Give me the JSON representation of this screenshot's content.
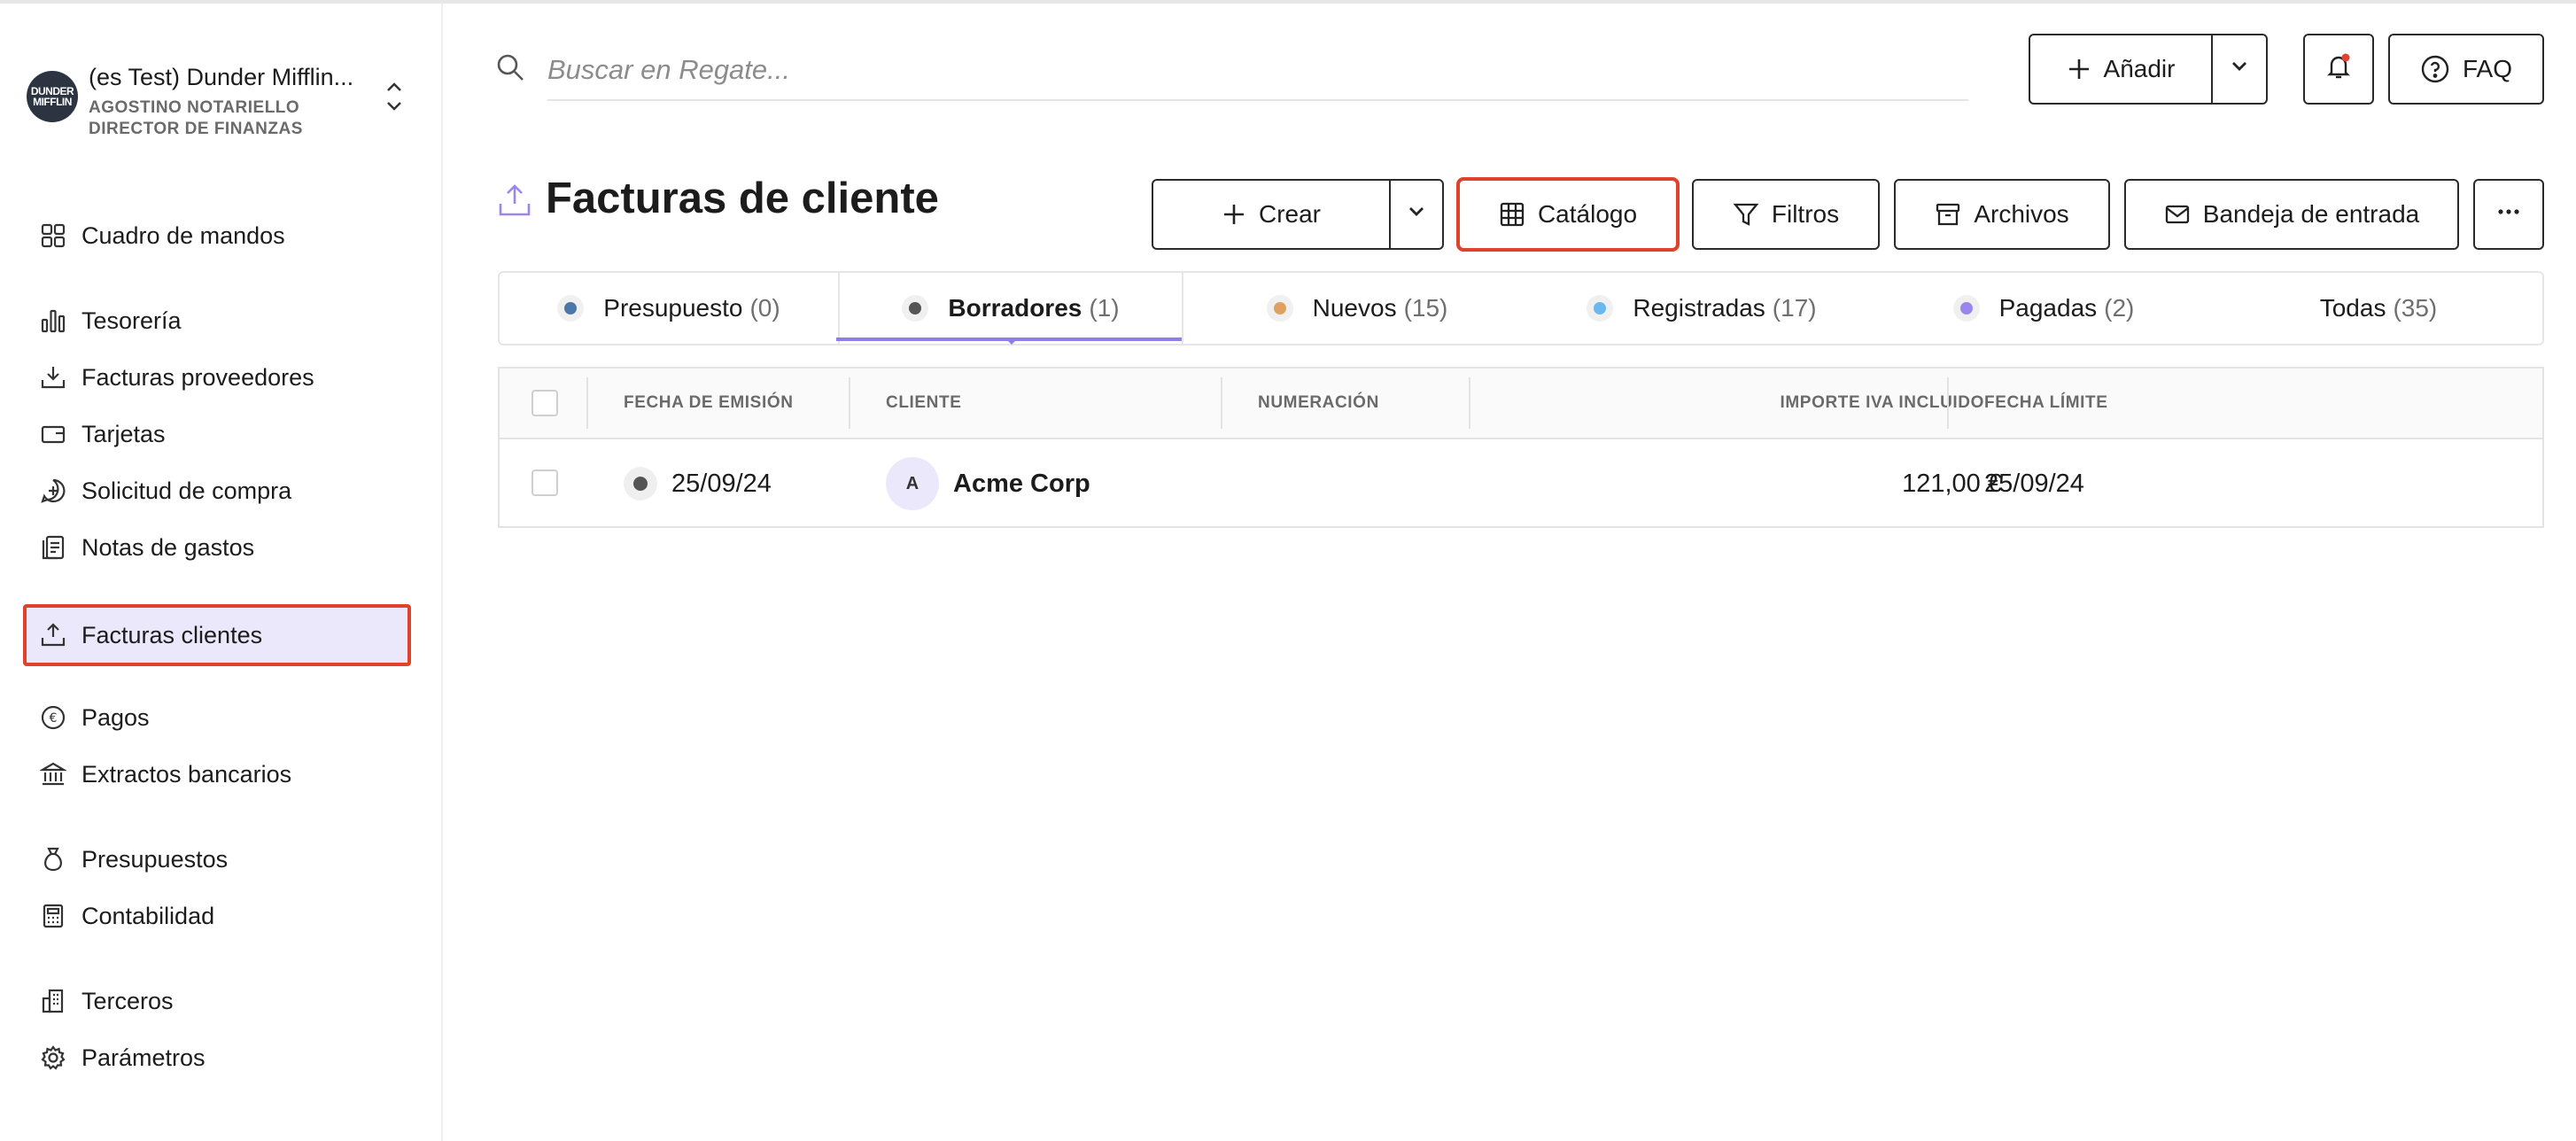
{
  "org": {
    "logo_text_1": "DUNDER",
    "logo_text_2": "MIFFLIN",
    "name": "(es Test) Dunder Mifflin...",
    "user_name": "AGOSTINO NOTARIELLO",
    "user_role": "DIRECTOR DE FINANZAS"
  },
  "sidebar": {
    "items": [
      {
        "label": "Cuadro de mandos",
        "icon": "dashboard-icon"
      },
      {
        "label": "Tesorería",
        "icon": "bar-chart-icon"
      },
      {
        "label": "Facturas proveedores",
        "icon": "download-tray-icon"
      },
      {
        "label": "Tarjetas",
        "icon": "wallet-icon"
      },
      {
        "label": "Solicitud de compra",
        "icon": "plus-chat-icon"
      },
      {
        "label": "Notas de gastos",
        "icon": "receipt-icon"
      },
      {
        "label": "Facturas clientes",
        "icon": "upload-tray-icon",
        "active": true
      },
      {
        "label": "Pagos",
        "icon": "euro-icon"
      },
      {
        "label": "Extractos bancarios",
        "icon": "bank-icon"
      },
      {
        "label": "Presupuestos",
        "icon": "money-bag-icon"
      },
      {
        "label": "Contabilidad",
        "icon": "calculator-icon"
      },
      {
        "label": "Terceros",
        "icon": "building-icon"
      },
      {
        "label": "Parámetros",
        "icon": "gear-icon"
      }
    ]
  },
  "search": {
    "placeholder": "Buscar en Regate..."
  },
  "topbar": {
    "add_label": "Añadir",
    "faq_label": "FAQ"
  },
  "page": {
    "title": "Facturas de cliente"
  },
  "toolbar": {
    "create_label": "Crear",
    "catalog_label": "Catálogo",
    "filters_label": "Filtros",
    "archives_label": "Archivos",
    "inbox_label": "Bandeja de entrada"
  },
  "tabs": [
    {
      "label": "Presupuesto",
      "count": "(0)",
      "color": "#4a78a8"
    },
    {
      "label": "Borradores",
      "count": "(1)",
      "color": "#555555",
      "active": true
    },
    {
      "label": "Nuevos",
      "count": "(15)",
      "color": "#e0a060"
    },
    {
      "label": "Registradas",
      "count": "(17)",
      "color": "#6cb8ee"
    },
    {
      "label": "Pagadas",
      "count": "(2)",
      "color": "#9b86ec"
    },
    {
      "label": "Todas",
      "count": "(35)"
    }
  ],
  "table": {
    "columns": [
      "FECHA DE EMISIÓN",
      "CLIENTE",
      "NUMERACIÓN",
      "IMPORTE IVA INCLUIDO",
      "FECHA LÍMITE"
    ],
    "rows": [
      {
        "issue_date": "25/09/24",
        "client_initial": "A",
        "client": "Acme Corp",
        "number": "",
        "amount": "121,00 €",
        "due_date": "25/09/24"
      }
    ]
  }
}
